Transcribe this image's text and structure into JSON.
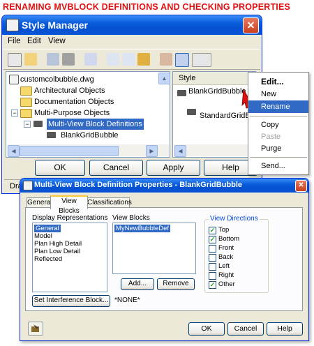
{
  "banner": "RENAMING MVBLOCK DEFINITIONS AND CHECKING PROPERTIES",
  "style_manager": {
    "title": "Style Manager",
    "menu": [
      "File",
      "Edit",
      "View"
    ],
    "tree": {
      "root": "customcolbubble.dwg",
      "items": [
        "Architectural Objects",
        "Documentation Objects",
        "Multi-Purpose Objects"
      ],
      "selected": "Multi-View Block Definitions",
      "child": "BlankGridBubble"
    },
    "style_header": "Style",
    "styles": [
      "BlankGridBubble",
      "StandardGridBu"
    ],
    "buttons": {
      "ok": "OK",
      "cancel": "Cancel",
      "apply": "Apply",
      "help": "Help"
    },
    "status_fragment": "Dra"
  },
  "context_menu": {
    "items": [
      "Edit...",
      "New",
      "Rename",
      "Copy",
      "Paste",
      "Purge",
      "Send..."
    ],
    "highlighted": "Rename"
  },
  "mvb_dialog": {
    "title": "Multi-View Block Definition Properties - BlankGridBubble",
    "tabs": [
      "General",
      "View Blocks",
      "Classifications"
    ],
    "active_tab": "View Blocks",
    "display_reps_label": "Display Representations",
    "display_reps": [
      "General",
      "Model",
      "Plan High Detail",
      "Plan Low Detail",
      "Reflected"
    ],
    "view_blocks_label": "View Blocks",
    "view_blocks": [
      "MyNewBubbleDef"
    ],
    "add_label": "Add...",
    "remove_label": "Remove",
    "view_directions_label": "View Directions",
    "view_directions": [
      {
        "label": "Top",
        "checked": true
      },
      {
        "label": "Bottom",
        "checked": true
      },
      {
        "label": "Front",
        "checked": false
      },
      {
        "label": "Back",
        "checked": false
      },
      {
        "label": "Left",
        "checked": false
      },
      {
        "label": "Right",
        "checked": false
      },
      {
        "label": "Other",
        "checked": true
      }
    ],
    "set_interference_label": "Set Interference Block...",
    "interference_value": "*NONE*",
    "buttons": {
      "ok": "OK",
      "cancel": "Cancel",
      "help": "Help"
    }
  },
  "colors": {
    "banner": "#e01010",
    "title_bar": "#0a5ddb",
    "selection": "#316ac5",
    "dialog_bg": "#ece9d8"
  }
}
